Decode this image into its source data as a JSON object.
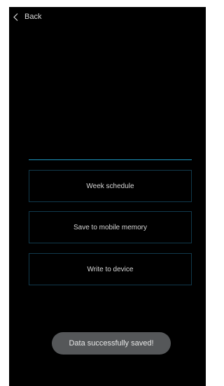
{
  "header": {
    "back_label": "Back",
    "back_icon": "chevron-left-icon"
  },
  "menu": {
    "items": [
      {
        "label": "Week schedule"
      },
      {
        "label": "Save to mobile memory"
      },
      {
        "label": "Write to device"
      }
    ]
  },
  "toast": {
    "message": "Data successfully saved!"
  },
  "colors": {
    "background": "#000000",
    "accent_line": "#1e95bd",
    "button_border": "#113a4d",
    "toast_background": "#555759"
  }
}
